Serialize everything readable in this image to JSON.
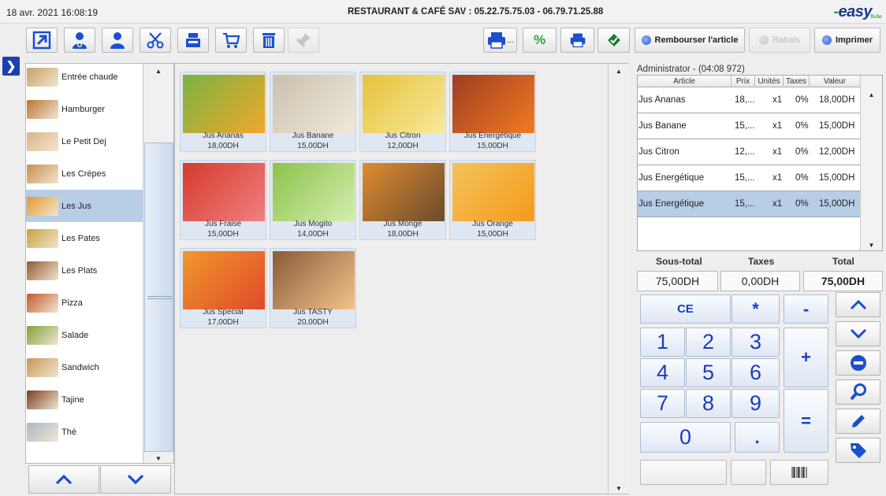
{
  "header": {
    "datetime": "18 avr. 2021  16:08:19",
    "restaurant": "RESTAURANT & CAFÉ  SAV : 05.22.75.75.03 - 06.79.71.25.88",
    "logo": "easy",
    "logo_sub": "To Do"
  },
  "toolbar": {
    "left_icons": [
      "switch-window-icon",
      "user-add-icon",
      "user-icon",
      "scissors-icon",
      "cash-register-icon",
      "cart-icon",
      "trash-icon",
      "pin-icon"
    ],
    "right": {
      "refund_label": "Rembourser l'article",
      "discount_label": "Rabais",
      "print_label": "Imprimer"
    }
  },
  "categories": [
    {
      "label": "Entrée chaude",
      "color": "#c9a06a"
    },
    {
      "label": "Hamburger",
      "color": "#b87532"
    },
    {
      "label": "Le Petit Dej",
      "color": "#d9b487"
    },
    {
      "label": "Les Crépes",
      "color": "#c98d4e"
    },
    {
      "label": "Les Jus",
      "color": "#e39a2a"
    },
    {
      "label": "Les Pates",
      "color": "#c8a03c"
    },
    {
      "label": "Les Plats",
      "color": "#8f5a2f"
    },
    {
      "label": "Pizza",
      "color": "#c4582c"
    },
    {
      "label": "Salade",
      "color": "#7fa33a"
    },
    {
      "label": "Sandwich",
      "color": "#c99559"
    },
    {
      "label": "Tajine",
      "color": "#7a3d22"
    },
    {
      "label": "Thé",
      "color": "#a8b9c6"
    }
  ],
  "products": [
    {
      "name": "Jus Ananas",
      "price": "18,00DH"
    },
    {
      "name": "Jus Banane",
      "price": "15,00DH"
    },
    {
      "name": "Jus Citron",
      "price": "12,00DH"
    },
    {
      "name": "Jus Energétique",
      "price": "15,00DH"
    },
    {
      "name": "Jus Fraise",
      "price": "15,00DH"
    },
    {
      "name": "Jus Mogito",
      "price": "14,00DH"
    },
    {
      "name": "Jus Monge",
      "price": "18,00DH"
    },
    {
      "name": "Jus Orange",
      "price": "15,00DH"
    },
    {
      "name": "Jus Special",
      "price": "17,00DH"
    },
    {
      "name": "Jus TASTY",
      "price": "20,00DH"
    }
  ],
  "ticket": {
    "operator": "Administrator - (04:08 972)",
    "columns": [
      "Article",
      "Prix",
      "Unités",
      "Taxes",
      "Valeur"
    ],
    "rows": [
      {
        "article": "Jus Ananas",
        "prix": "18,...",
        "unites": "x1",
        "taxes": "0%",
        "valeur": "18,00DH"
      },
      {
        "article": "Jus Banane",
        "prix": "15,...",
        "unites": "x1",
        "taxes": "0%",
        "valeur": "15,00DH"
      },
      {
        "article": "Jus Citron",
        "prix": "12,...",
        "unites": "x1",
        "taxes": "0%",
        "valeur": "12,00DH"
      },
      {
        "article": "Jus Energétique",
        "prix": "15,...",
        "unites": "x1",
        "taxes": "0%",
        "valeur": "15,00DH"
      },
      {
        "article": "Jus Energétique",
        "prix": "15,...",
        "unites": "x1",
        "taxes": "0%",
        "valeur": "15,00DH"
      }
    ]
  },
  "totals": {
    "subtotal_label": "Sous-total",
    "taxes_label": "Taxes",
    "total_label": "Total",
    "subtotal": "75,00DH",
    "taxes": "0,00DH",
    "total": "75,00DH"
  },
  "keypad": {
    "ce": "CE",
    "star": "*",
    "minus": "-",
    "plus": "+",
    "equals": "=",
    "dot": ".",
    "digits": [
      "1",
      "2",
      "3",
      "4",
      "5",
      "6",
      "7",
      "8",
      "9",
      "0"
    ]
  }
}
